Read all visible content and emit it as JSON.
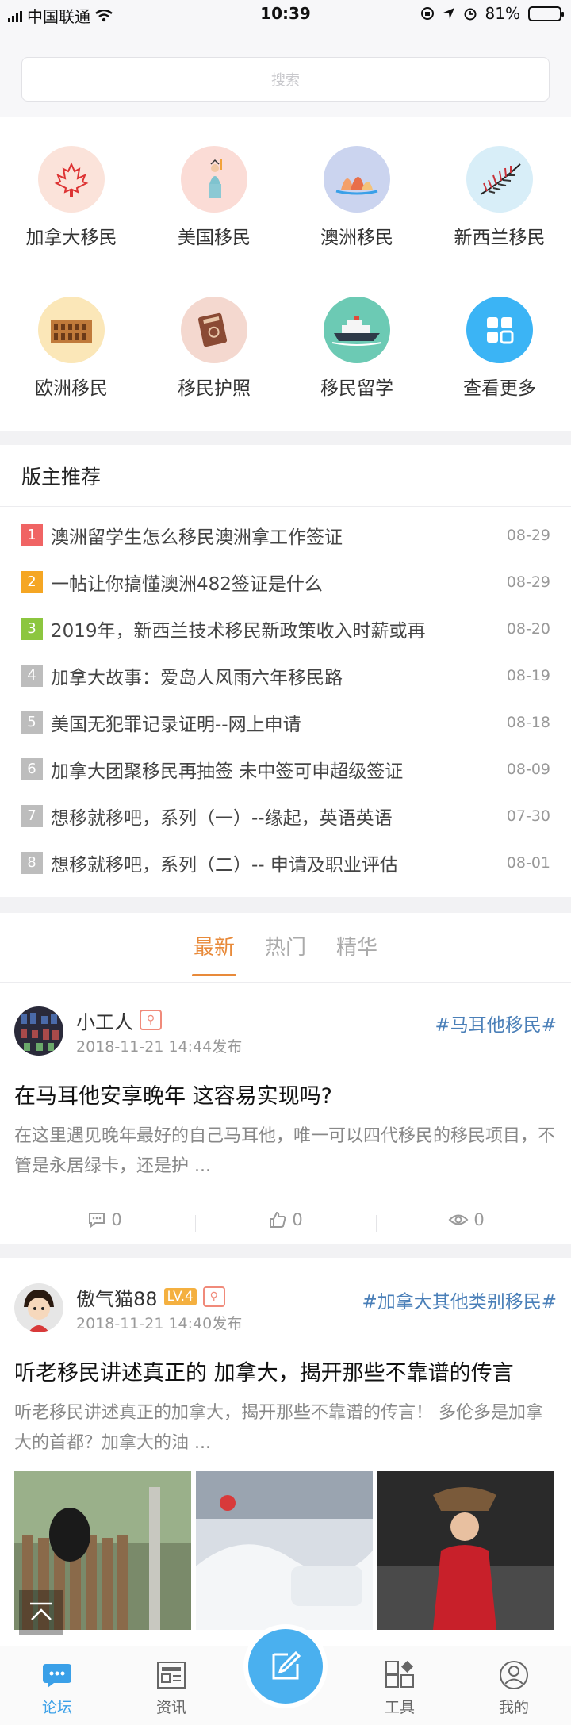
{
  "status": {
    "carrier": "中国联通",
    "time": "10:39",
    "battery": "81%",
    "battery_level": 0.81
  },
  "search": {
    "placeholder": "搜索"
  },
  "categories": [
    {
      "label": "加拿大移民",
      "icon": "maple-leaf-icon"
    },
    {
      "label": "美国移民",
      "icon": "statue-of-liberty-icon"
    },
    {
      "label": "澳洲移民",
      "icon": "opera-house-icon"
    },
    {
      "label": "新西兰移民",
      "icon": "fern-icon"
    },
    {
      "label": "欧洲移民",
      "icon": "colosseum-icon"
    },
    {
      "label": "移民护照",
      "icon": "passport-icon"
    },
    {
      "label": "移民留学",
      "icon": "ship-icon"
    },
    {
      "label": "查看更多",
      "icon": "grid-icon"
    }
  ],
  "recommend": {
    "title": "版主推荐",
    "items": [
      {
        "num": "1",
        "title": "澳洲留学生怎么移民澳洲拿工作签证",
        "date": "08-29",
        "color": "#f06464"
      },
      {
        "num": "2",
        "title": "一帖让你搞懂澳洲482签证是什么",
        "date": "08-29",
        "color": "#f5a623"
      },
      {
        "num": "3",
        "title": "2019年，新西兰技术移民新政策收入时薪或再",
        "date": "08-20",
        "color": "#8cc63f"
      },
      {
        "num": "4",
        "title": "加拿大故事：爱岛人风雨六年移民路",
        "date": "08-19",
        "color": "#bdbdbd"
      },
      {
        "num": "5",
        "title": "美国无犯罪记录证明--网上申请",
        "date": "08-18",
        "color": "#bdbdbd"
      },
      {
        "num": "6",
        "title": "加拿大团聚移民再抽签 未中签可申超级签证",
        "date": "08-09",
        "color": "#bdbdbd"
      },
      {
        "num": "7",
        "title": "想移就移吧，系列（一）--缘起，英语英语",
        "date": "07-30",
        "color": "#bdbdbd"
      },
      {
        "num": "8",
        "title": "想移就移吧，系列（二）-- 申请及职业评估",
        "date": "08-01",
        "color": "#bdbdbd"
      }
    ]
  },
  "tabs": [
    {
      "label": "最新",
      "active": true
    },
    {
      "label": "热门"
    },
    {
      "label": "精华"
    }
  ],
  "posts": [
    {
      "user": "小工人",
      "time": "2018-11-21 14:44发布",
      "tag": "#马耳他移民#",
      "title": "在马耳他安享晚年 这容易实现吗?",
      "excerpt": "在这里遇见晚年最好的自己马耳他，唯一可以四代移民的移民项目，不管是永居绿卡，还是护 ...",
      "comments": "0",
      "likes": "0",
      "views": "0"
    },
    {
      "user": "傲气猫88",
      "level": "LV.4",
      "time": "2018-11-21 14:40发布",
      "tag": "#加拿大其他类别移民#",
      "title": "听老移民讲述真正的 加拿大，揭开那些不靠谱的传言",
      "excerpt": "听老移民讲述真正的加拿大，揭开那些不靠谱的传言！ 多伦多是加拿大的首都？加拿大的油 ..."
    }
  ],
  "tabbar": [
    {
      "label": "论坛",
      "active": true
    },
    {
      "label": "资讯"
    },
    {
      "label": ""
    },
    {
      "label": "工具"
    },
    {
      "label": "我的"
    }
  ],
  "colors": {
    "accent": "#e88a3a",
    "primary": "#3aa0e8",
    "tag": "#4a7fb8"
  }
}
